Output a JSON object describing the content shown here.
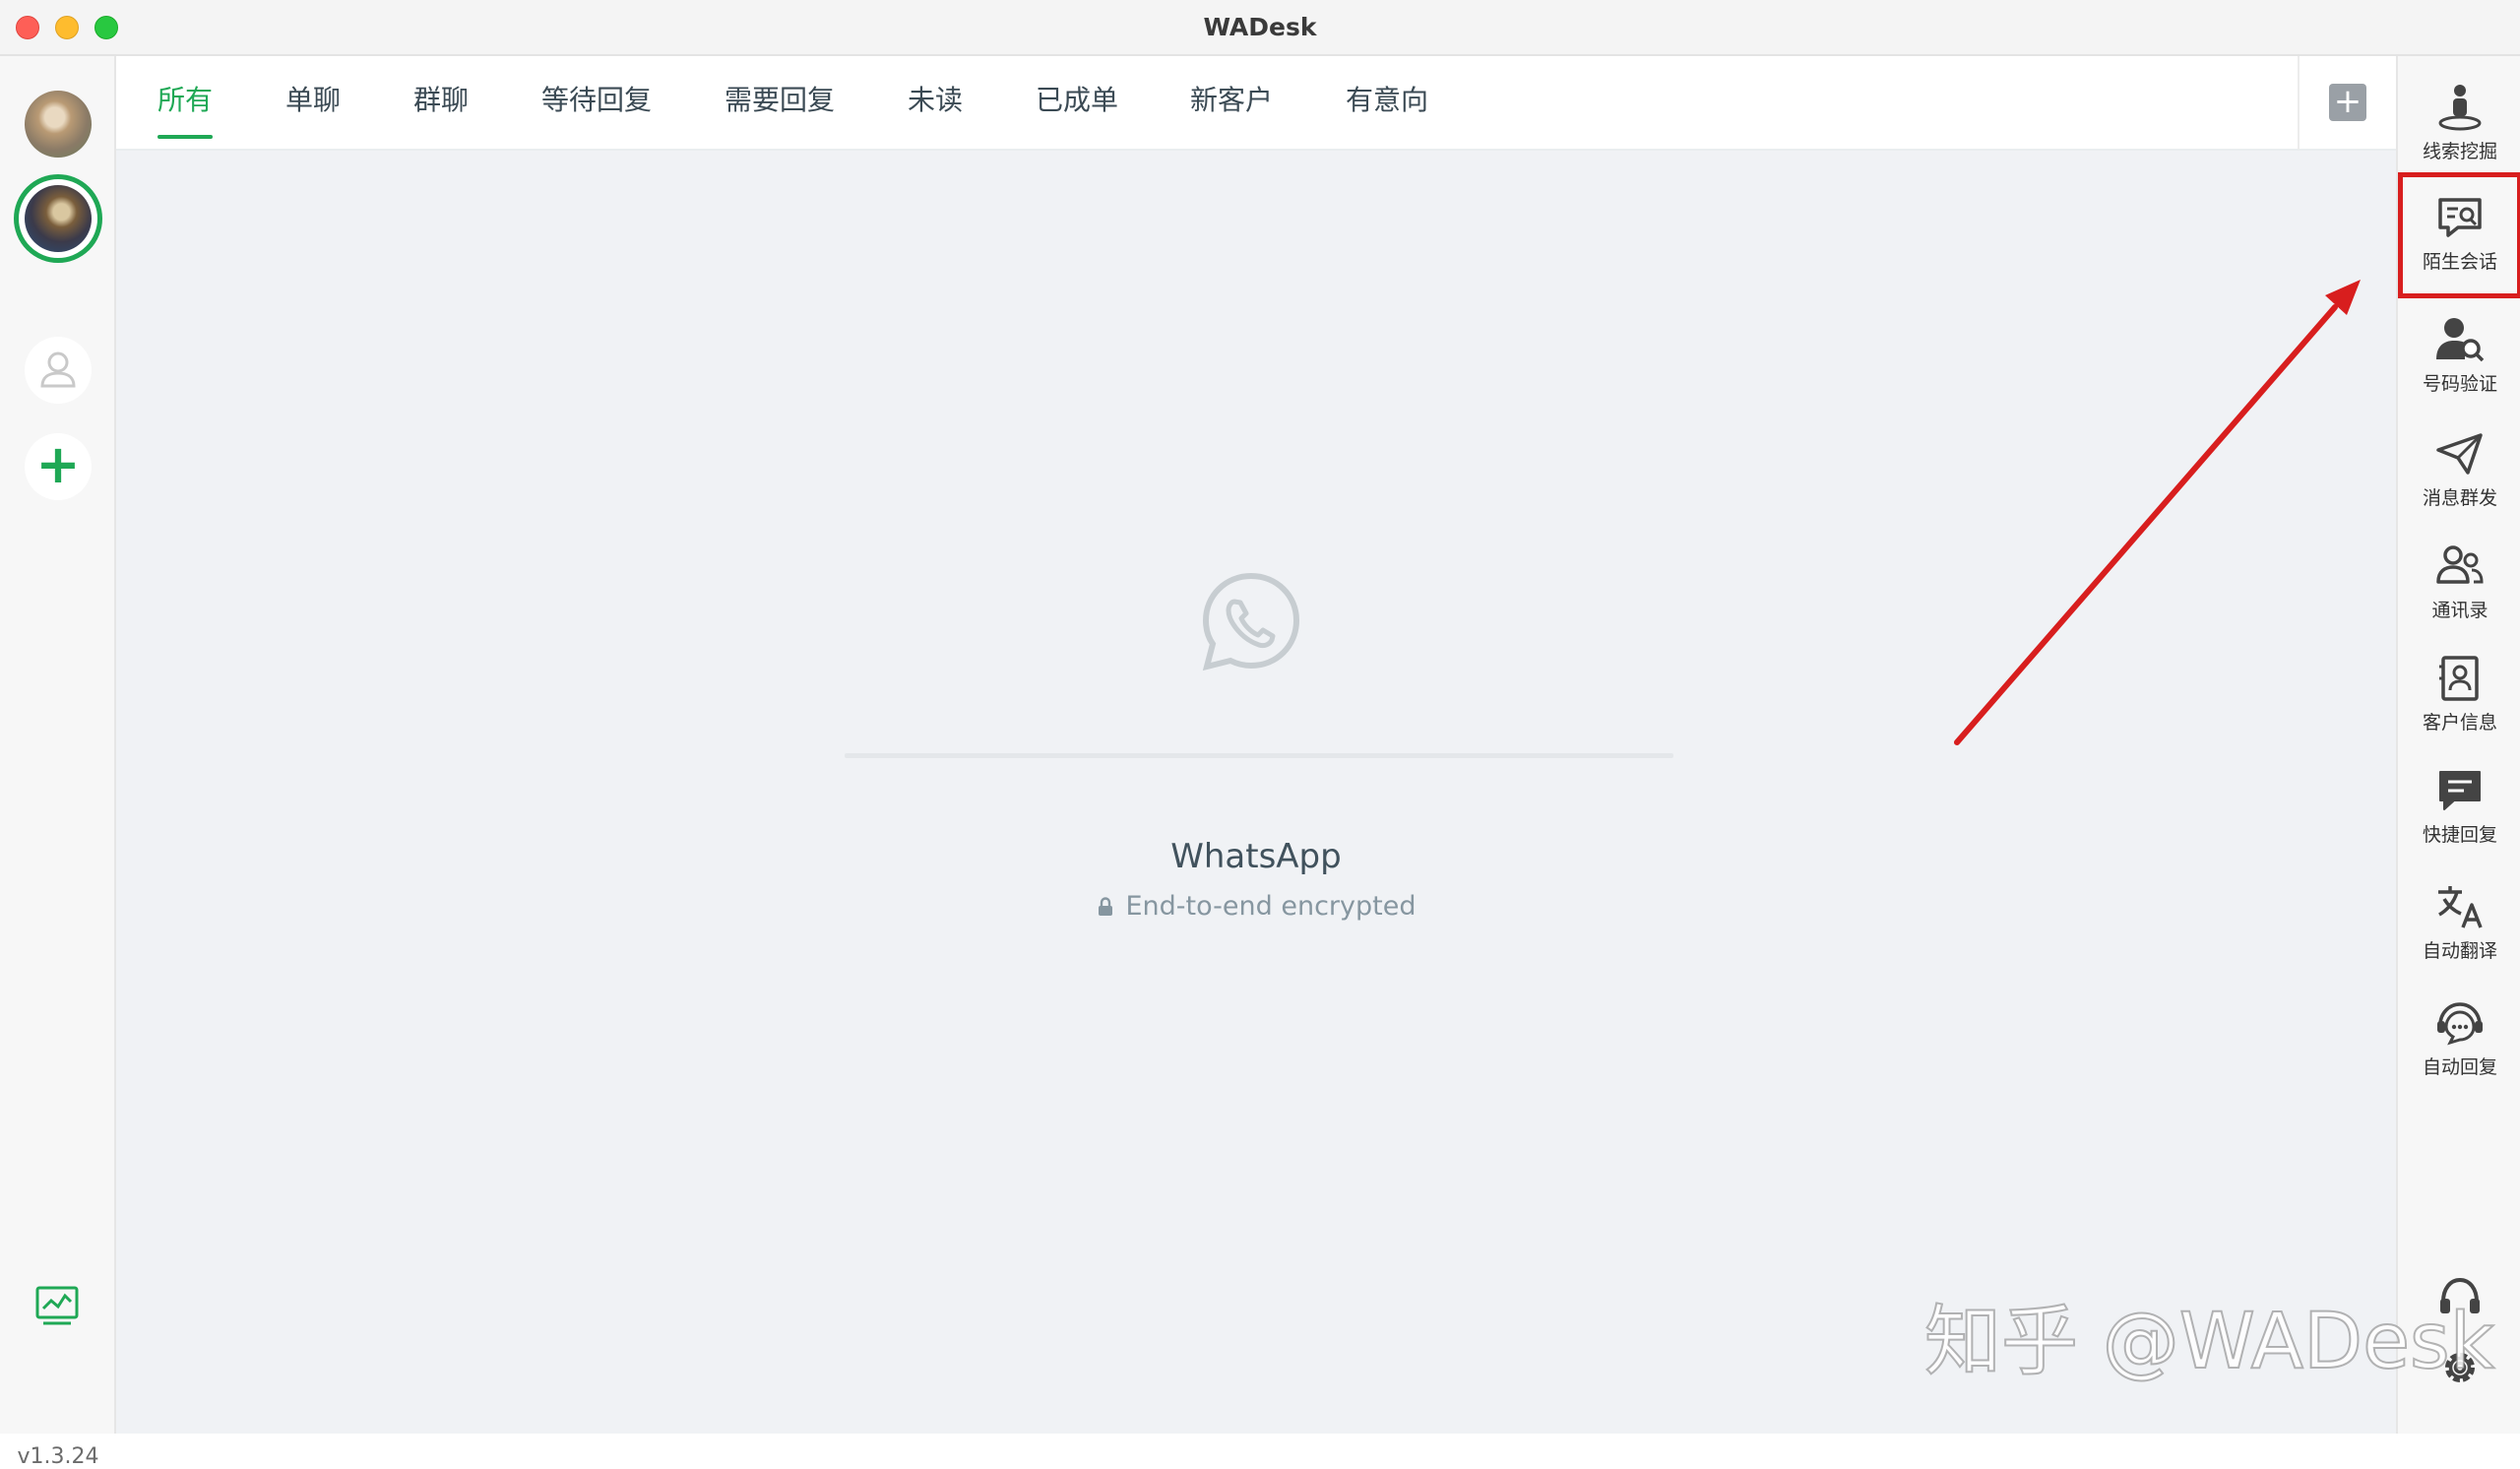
{
  "window": {
    "title": "WADesk"
  },
  "left_sidebar": {
    "version": "v1.3.24"
  },
  "tabs": [
    {
      "label": "所有",
      "active": true
    },
    {
      "label": "单聊",
      "active": false
    },
    {
      "label": "群聊",
      "active": false
    },
    {
      "label": "等待回复",
      "active": false
    },
    {
      "label": "需要回复",
      "active": false
    },
    {
      "label": "未读",
      "active": false
    },
    {
      "label": "已成单",
      "active": false
    },
    {
      "label": "新客户",
      "active": false
    },
    {
      "label": "有意向",
      "active": false
    }
  ],
  "main": {
    "title": "WhatsApp",
    "subtitle": "End-to-end encrypted"
  },
  "toolbar": [
    {
      "label": "线索挖掘",
      "icon": "person-podium-icon"
    },
    {
      "label": "陌生会话",
      "icon": "chat-search-icon"
    },
    {
      "label": "号码验证",
      "icon": "user-search-icon"
    },
    {
      "label": "消息群发",
      "icon": "paper-plane-icon"
    },
    {
      "label": "通讯录",
      "icon": "contacts-icon"
    },
    {
      "label": "客户信息",
      "icon": "id-card-icon"
    },
    {
      "label": "快捷回复",
      "icon": "message-icon"
    },
    {
      "label": "自动翻译",
      "icon": "translate-icon"
    },
    {
      "label": "自动回复",
      "icon": "chat-bot-icon"
    }
  ],
  "watermark": "知乎 @WADesk",
  "colors": {
    "accent": "#1fa855",
    "highlight": "#d81e1e",
    "main_bg": "#f0f2f5"
  }
}
